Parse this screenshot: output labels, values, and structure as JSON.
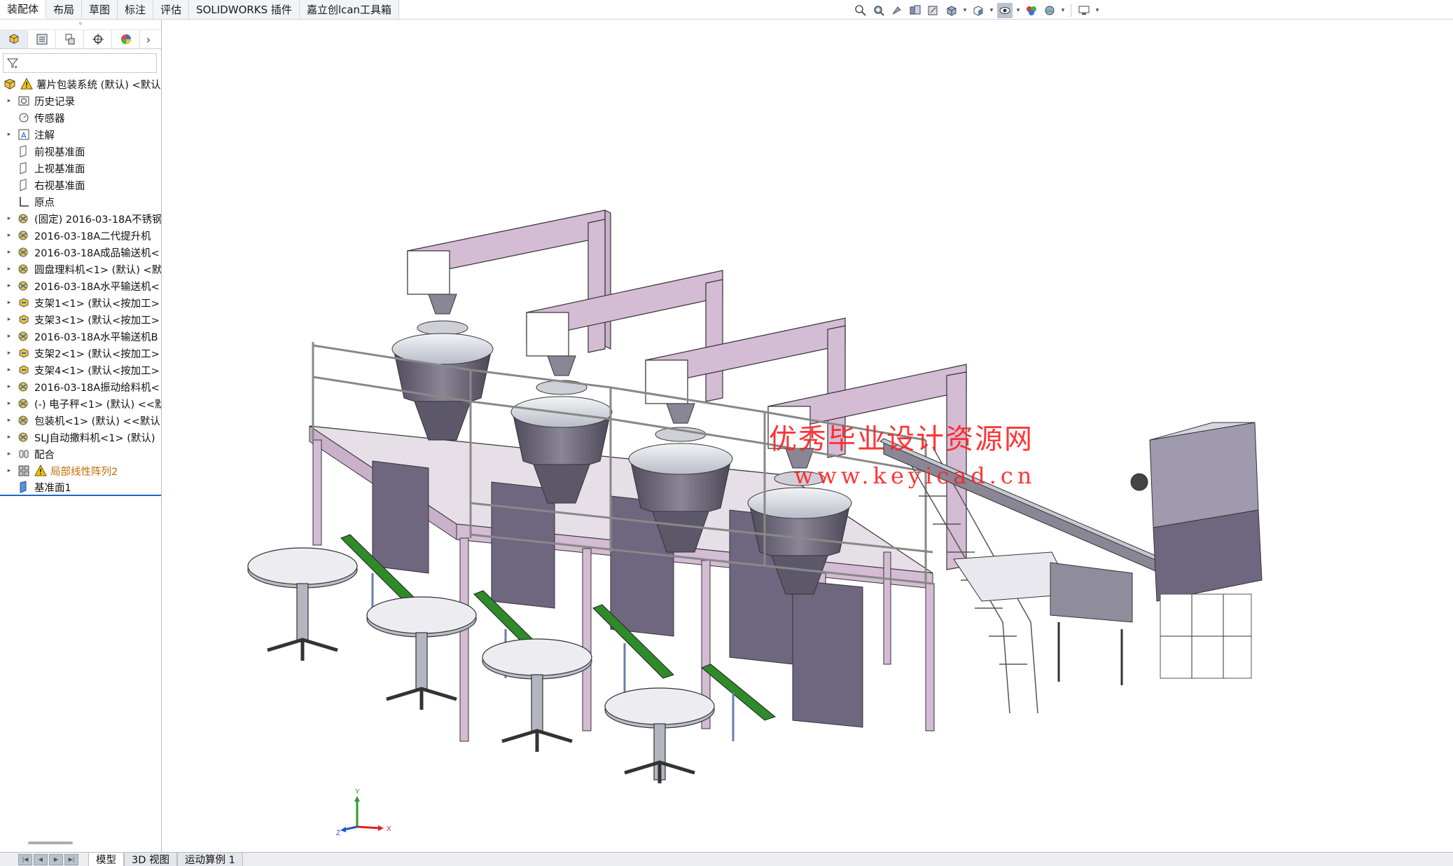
{
  "command_tabs": [
    "装配体",
    "布局",
    "草图",
    "标注",
    "评估",
    "SOLIDWORKS 插件",
    "嘉立创lcan工具箱"
  ],
  "view_toolbar": {
    "buttons": [
      "zoom-to-fit-icon",
      "zoom-to-area-icon",
      "previous-view-icon",
      "section-view-icon",
      "dynamic-annotation-icon",
      "view-orientation-icon",
      "display-style-icon",
      "hide-show-items-icon",
      "edit-appearance-icon",
      "apply-scene-icon",
      "view-settings-icon"
    ]
  },
  "feature_manager": {
    "tabs": [
      "featuremanager-tab-icon",
      "propertymanager-tab-icon",
      "configurationmanager-tab-icon",
      "dimxpert-tab-icon",
      "display-manager-tab-icon"
    ],
    "filter_icon": "filter-icon",
    "tree": [
      {
        "label": "薯片包装系统 (默认) <默认",
        "icon": "assembly-icon",
        "warning": true,
        "caret": false,
        "style": "root"
      },
      {
        "label": "历史记录",
        "icon": "history-icon",
        "caret": true
      },
      {
        "label": "传感器",
        "icon": "sensor-icon",
        "caret": false
      },
      {
        "label": "注解",
        "icon": "annotation-icon",
        "caret": true
      },
      {
        "label": "前视基准面",
        "icon": "plane-icon",
        "caret": false
      },
      {
        "label": "上视基准面",
        "icon": "plane-icon",
        "caret": false
      },
      {
        "label": "右视基准面",
        "icon": "plane-icon",
        "caret": false
      },
      {
        "label": "原点",
        "icon": "origin-icon",
        "caret": false
      },
      {
        "label": "(固定) 2016-03-18A不锈钢",
        "icon": "subassembly-icon",
        "caret": true
      },
      {
        "label": "2016-03-18A二代提升机",
        "icon": "subassembly-icon",
        "caret": true
      },
      {
        "label": "2016-03-18A成品输送机<",
        "icon": "subassembly-icon",
        "caret": true
      },
      {
        "label": "圆盘理料机<1> (默认) <默",
        "icon": "subassembly-icon",
        "caret": true
      },
      {
        "label": "2016-03-18A水平输送机<",
        "icon": "subassembly-icon",
        "caret": true
      },
      {
        "label": "支架1<1> (默认<按加工>",
        "icon": "part-icon",
        "caret": true
      },
      {
        "label": "支架3<1> (默认<按加工>",
        "icon": "part-icon",
        "caret": true
      },
      {
        "label": "2016-03-18A水平输送机B",
        "icon": "subassembly-icon",
        "caret": true
      },
      {
        "label": "支架2<1> (默认<按加工>",
        "icon": "part-icon",
        "caret": true
      },
      {
        "label": "支架4<1> (默认<按加工>",
        "icon": "part-icon",
        "caret": true
      },
      {
        "label": "2016-03-18A振动给料机<",
        "icon": "subassembly-icon",
        "caret": true
      },
      {
        "label": "(-) 电子秤<1> (默认) <<默",
        "icon": "subassembly-icon",
        "caret": true
      },
      {
        "label": "包装机<1> (默认) <<默认",
        "icon": "subassembly-icon",
        "caret": true
      },
      {
        "label": "SLJ自动撒料机<1> (默认)",
        "icon": "subassembly-icon",
        "caret": true
      },
      {
        "label": "配合",
        "icon": "mates-icon",
        "caret": true
      },
      {
        "label": "局部线性阵列2",
        "icon": "linear-pattern-icon",
        "caret": true,
        "warning": true,
        "style": "orange"
      },
      {
        "label": "基准面1",
        "icon": "plane-blue-icon",
        "caret": false,
        "style": "selected"
      }
    ]
  },
  "graphics": {
    "watermark_cn": "优秀毕业设计资源网",
    "watermark_url": "www.keyicad.cn",
    "triad": {
      "x": "X",
      "y": "Y",
      "z": "Z"
    }
  },
  "bottom_tabs": [
    "模型",
    "3D 视图",
    "运动算例 1"
  ],
  "colors": {
    "frame_pink": "#d4bcd4",
    "hopper_gray": "#6c6878",
    "panel_purple": "#6f6680",
    "accent_green": "#2f8a2a",
    "selection_blue": "#1e66c4",
    "watermark_red": "#ff2020"
  }
}
